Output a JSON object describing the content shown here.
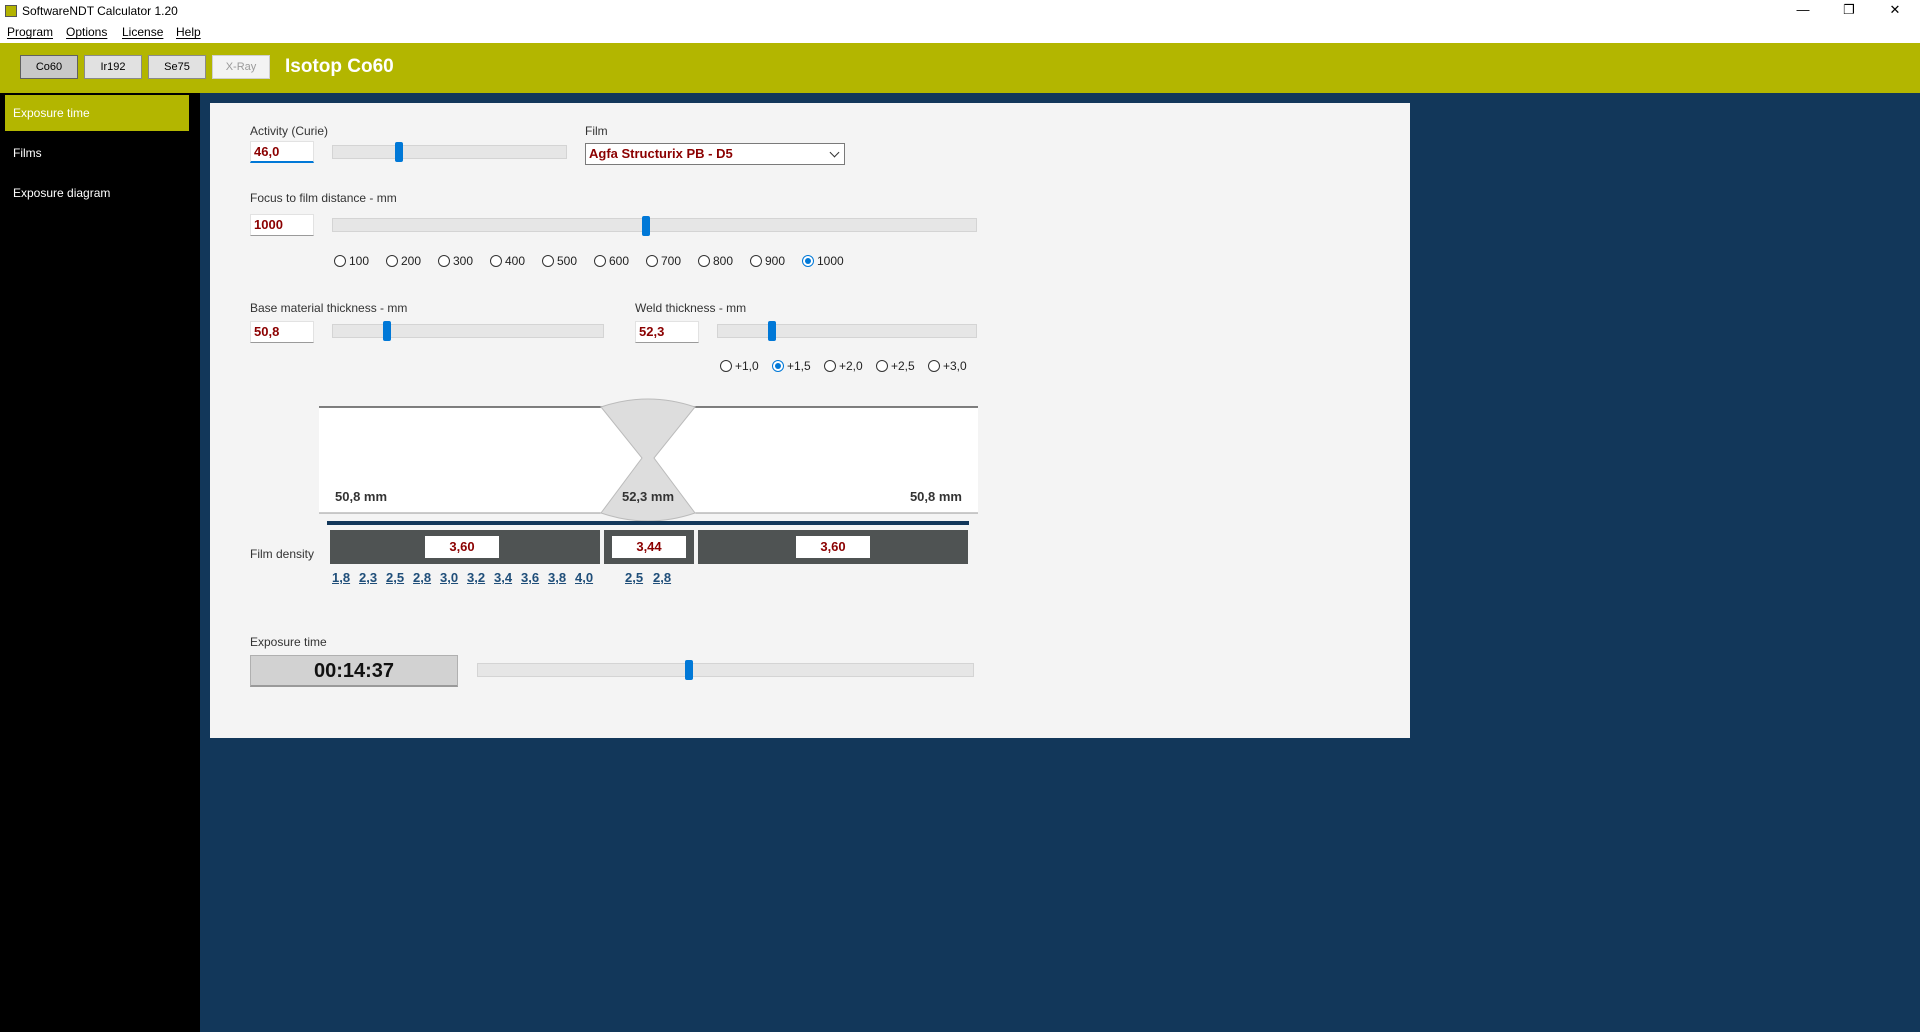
{
  "window": {
    "title": "SoftwareNDT Calculator 1.20",
    "controls": {
      "minimize": "—",
      "maximize": "❐",
      "close": "✕"
    }
  },
  "menu": [
    "Program",
    "Options",
    "License",
    "Help"
  ],
  "isotopes": [
    {
      "label": "Co60",
      "state": "active"
    },
    {
      "label": "Ir192",
      "state": "normal"
    },
    {
      "label": "Se75",
      "state": "normal"
    },
    {
      "label": "X-Ray",
      "state": "disabled"
    }
  ],
  "header_title": "Isotop Co60",
  "sidebar": {
    "items": [
      {
        "label": "Exposure time",
        "active": true
      },
      {
        "label": "Films",
        "active": false
      },
      {
        "label": "Exposure diagram",
        "active": false
      }
    ]
  },
  "form": {
    "activity": {
      "label": "Activity (Curie)",
      "value": "46,0"
    },
    "film": {
      "label": "Film",
      "value": "Agfa Structurix PB - D5"
    },
    "focus": {
      "label": "Focus to film distance - mm",
      "value": "1000",
      "options": [
        "100",
        "200",
        "300",
        "400",
        "500",
        "600",
        "700",
        "800",
        "900",
        "1000"
      ],
      "selected": "1000"
    },
    "base": {
      "label": "Base material thickness - mm",
      "value": "50,8"
    },
    "weld": {
      "label": "Weld thickness - mm",
      "value": "52,3",
      "options": [
        "+1,0",
        "+1,5",
        "+2,0",
        "+2,5",
        "+3,0"
      ],
      "selected": "+1,5"
    },
    "diagram": {
      "left_label": "50,8 mm",
      "center_label": "52,3 mm",
      "right_label": "50,8 mm"
    },
    "density": {
      "label": "Film density",
      "left": "3,60",
      "center": "3,44",
      "right": "3,60",
      "base_options": [
        "1,8",
        "2,3",
        "2,5",
        "2,8",
        "3,0",
        "3,2",
        "3,4",
        "3,6",
        "3,8",
        "4,0"
      ],
      "weld_options": [
        "2,5",
        "2,8"
      ]
    },
    "exposure": {
      "label": "Exposure time",
      "value": "00:14:37"
    }
  },
  "colors": {
    "accent": "#b3b600",
    "background": "#12375a",
    "sidebar": "#000000",
    "value_text": "#8b0000",
    "slider_thumb": "#0078d7"
  }
}
